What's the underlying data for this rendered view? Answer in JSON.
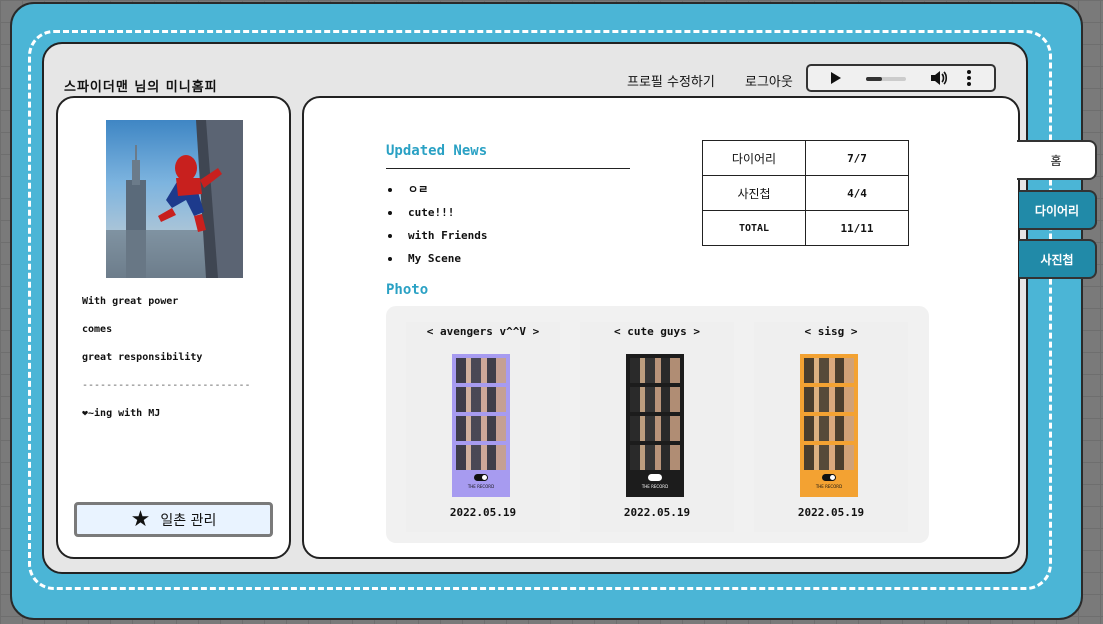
{
  "header": {
    "title": "스파이더맨 님의 미니홈피",
    "edit_profile": "프로필 수정하기",
    "logout": "로그아웃"
  },
  "player": {
    "progress": 0.4,
    "icons": [
      "play-icon",
      "volume-icon",
      "more-vertical-icon"
    ]
  },
  "profile": {
    "image_alt": "spiderman",
    "bio": [
      "With great power",
      "comes",
      "great responsibility",
      "----------------------------",
      "❤~ing with MJ"
    ],
    "manage_button": "일촌 관리"
  },
  "news": {
    "title": "Updated News",
    "items": [
      "ㅇㄹ",
      "cute!!!",
      "with Friends",
      "My Scene"
    ]
  },
  "stats": [
    {
      "label": "다이어리",
      "value": "7/7"
    },
    {
      "label": "사진첩",
      "value": "4/4"
    },
    {
      "label": "TOTAL",
      "value": "11/11"
    }
  ],
  "photo": {
    "title": "Photo",
    "cards": [
      {
        "caption": "< avengers v^^V >",
        "date": "2022.05.19",
        "bg": "#a79bf0"
      },
      {
        "caption": "< cute guys >",
        "date": "2022.05.19",
        "bg": "#1c1c1c"
      },
      {
        "caption": "< sisg >",
        "date": "2022.05.19",
        "bg": "#f3a232"
      }
    ],
    "brand": "THE RECORD"
  },
  "tabs": [
    {
      "label": "홈",
      "active": true
    },
    {
      "label": "다이어리",
      "active": false
    },
    {
      "label": "사진첩",
      "active": false
    }
  ],
  "colors": {
    "background": "#4bb5d6",
    "accent": "#2aa1c4",
    "tab_inactive": "#218aa8"
  }
}
